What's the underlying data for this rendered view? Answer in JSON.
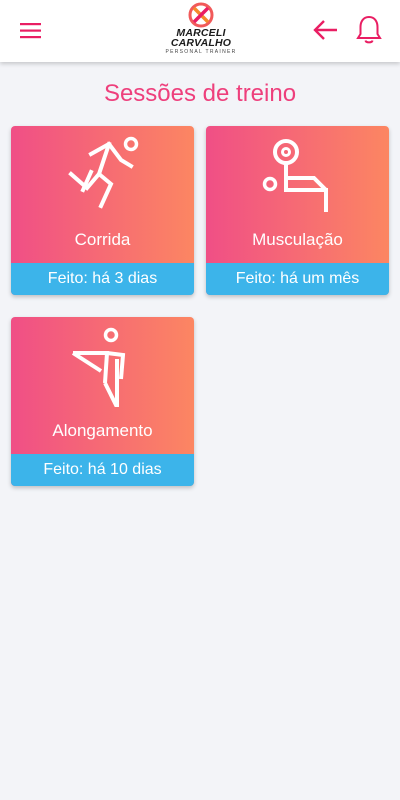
{
  "header": {
    "logo_line1": "MARCELI",
    "logo_line2": "CARVALHO",
    "logo_tagline": "PERSONAL TRAINER",
    "accent_color": "#e91e63"
  },
  "page": {
    "title": "Sessões de treino"
  },
  "sessions": [
    {
      "label": "Corrida",
      "status": "Feito: há 3 dias",
      "icon": "running-icon"
    },
    {
      "label": "Musculação",
      "status": "Feito: há um mês",
      "icon": "weightlifting-icon"
    },
    {
      "label": "Alongamento",
      "status": "Feito: há 10 dias",
      "icon": "stretching-icon"
    }
  ],
  "colors": {
    "card_gradient_start": "#f04f86",
    "card_gradient_end": "#fc8662",
    "status_bar": "#3cb4ea",
    "title": "#ee3f7c"
  }
}
